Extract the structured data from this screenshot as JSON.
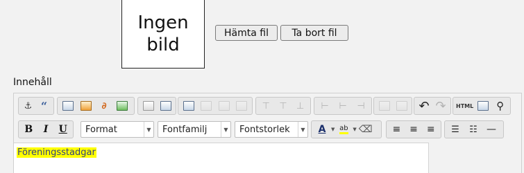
{
  "image_placeholder": {
    "text": "Ingen\nbild"
  },
  "buttons": {
    "fetch_file": "Hämta fil",
    "remove_file": "Ta bort fil"
  },
  "content_label": "Innehåll",
  "editor": {
    "toolbar_row2": {
      "bold": "B",
      "italic": "I",
      "underline": "U",
      "format": "Format",
      "font_family": "Fontfamilj",
      "font_size": "Fontstorlek",
      "text_color": "A",
      "highlight": "ab",
      "source": "HTML"
    },
    "body_text": "Föreningsstadgar",
    "highlight_color": "#ffff00"
  }
}
